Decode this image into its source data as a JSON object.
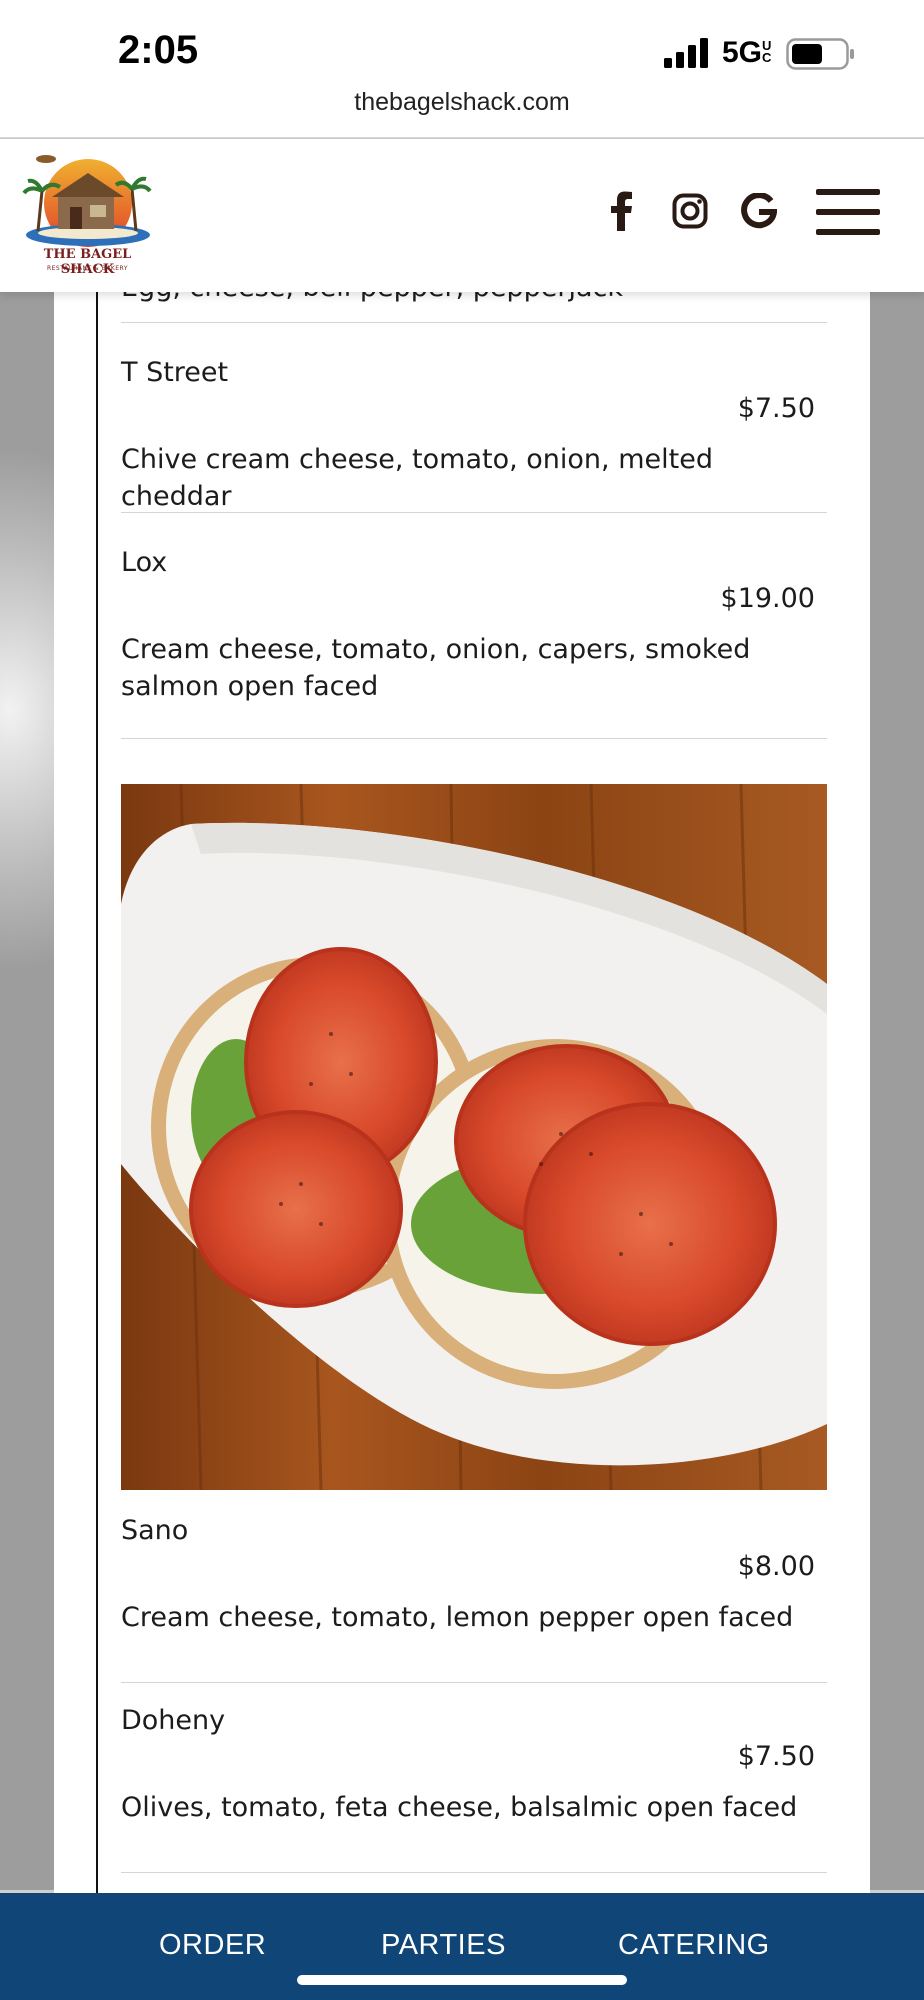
{
  "status_bar": {
    "time": "2:05",
    "network": "5G",
    "network_suffix": "UC",
    "url": "thebagelshack.com"
  },
  "header": {
    "logo_text": "THE BAGEL SHACK",
    "logo_subtext": "RESTAURANT & BAKERY",
    "social_icons": [
      "facebook-icon",
      "instagram-icon",
      "google-icon"
    ],
    "menu_icon": "hamburger-menu-icon"
  },
  "menu": {
    "cutoff_text": "Egg, cheese, bell pepper, pepperjack",
    "items": [
      {
        "name": "T Street",
        "price": "$7.50",
        "description": "Chive cream cheese, tomato, onion, melted cheddar"
      },
      {
        "name": "Lox",
        "price": "$19.00",
        "description": "Cream cheese, tomato, onion, capers, smoked salmon open faced"
      },
      {
        "name": "Sano",
        "price": "$8.00",
        "description": "Cream cheese, tomato, lemon pepper open faced"
      },
      {
        "name": "Doheny",
        "price": "$7.50",
        "description": "Olives, tomato, feta cheese, balsalmic open faced"
      }
    ],
    "photo": "bagel-tomato-photo"
  },
  "bottom_nav": {
    "links": [
      "ORDER",
      "PARTIES",
      "CATERING"
    ]
  },
  "colors": {
    "nav_bg": "#0f4577",
    "text": "#1c1c1c",
    "wood": "#8a3f12",
    "tomato": "#d84a2a"
  }
}
